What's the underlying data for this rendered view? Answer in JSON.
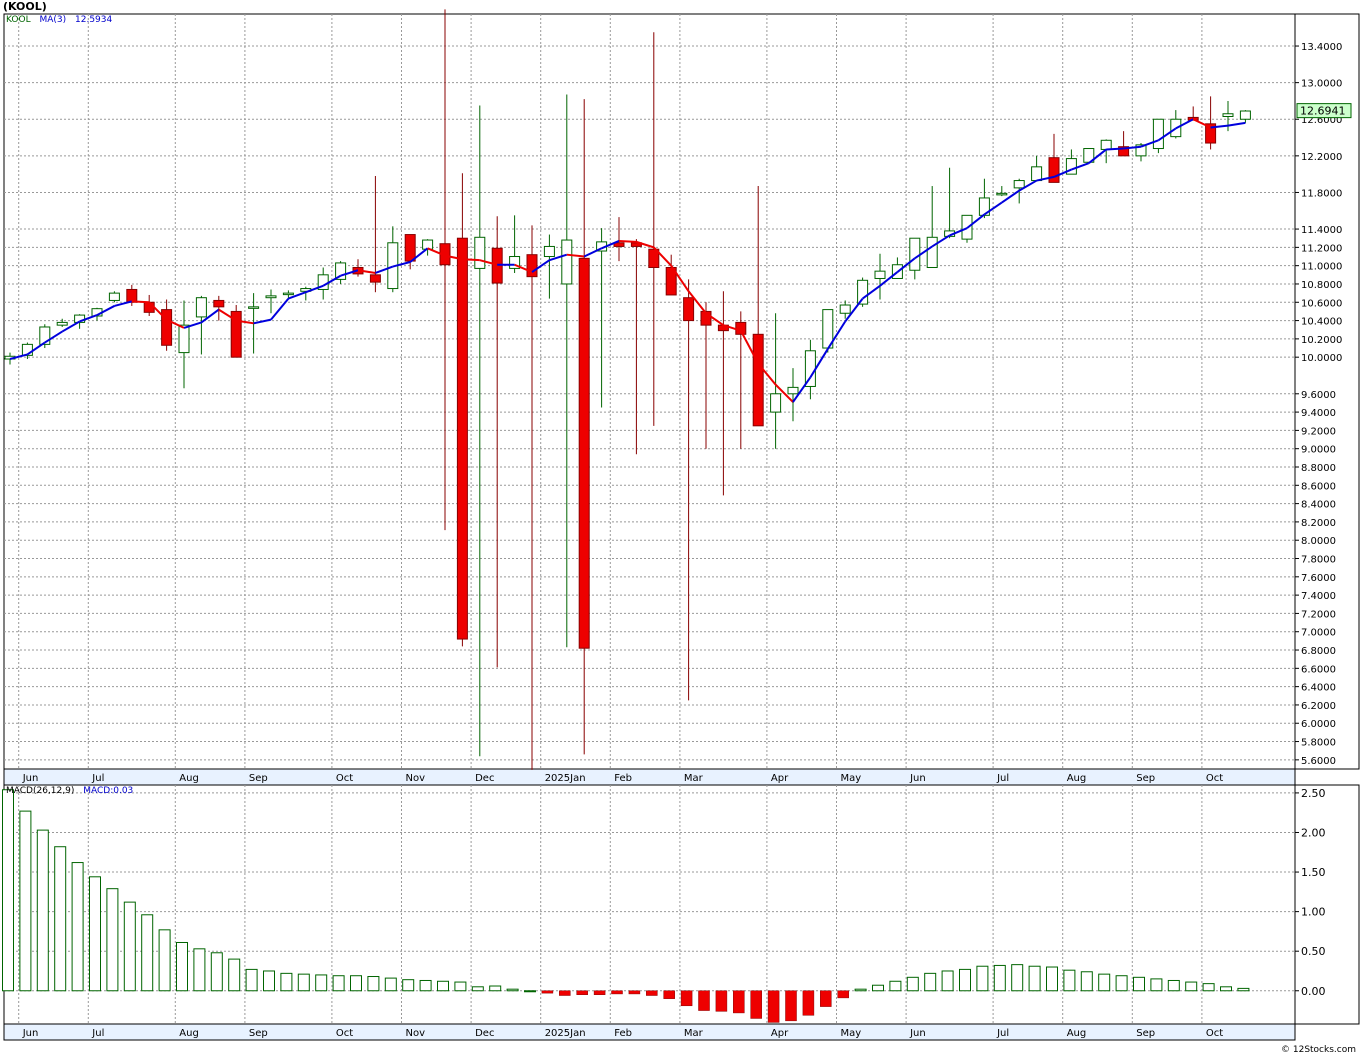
{
  "header": {
    "title": "(KOOL)"
  },
  "price_legend": {
    "symbol": "KOOL",
    "ma_label": "MA(3)",
    "ma_value": "12.5934"
  },
  "macd_legend": {
    "label": "MACD(26,12,9)",
    "value": "MACD:0.03"
  },
  "last_price": "12.6941",
  "credit": "© 12Stocks.com",
  "colors": {
    "up": "#ffffff",
    "up_stroke": "#006400",
    "down": "#ee0000",
    "down_stroke": "#880000",
    "ma_up": "#0000dd",
    "ma_down": "#ee0000",
    "price_tag": "#ccffcc"
  },
  "chart_data": [
    {
      "type": "candlestick",
      "title": "",
      "ylim": [
        5.5,
        13.75
      ],
      "y_ticks": [
        "13.4000",
        "13.0000",
        "12.6000",
        "12.2000",
        "11.8000",
        "11.4000",
        "11.2000",
        "11.0000",
        "10.8000",
        "10.6000",
        "10.4000",
        "10.2000",
        "10.0000",
        "9.6000",
        "9.4000",
        "9.2000",
        "9.0000",
        "8.8000",
        "8.6000",
        "8.4000",
        "8.2000",
        "8.0000",
        "7.8000",
        "7.6000",
        "7.4000",
        "7.2000",
        "7.0000",
        "6.8000",
        "6.6000",
        "6.4000",
        "6.2000",
        "6.0000",
        "5.8000",
        "5.6000"
      ],
      "month_labels": [
        "Jun",
        "Jul",
        "Aug",
        "Sep",
        "Oct",
        "Nov",
        "Dec",
        "2025Jan",
        "Feb",
        "Mar",
        "Apr",
        "May",
        "Jun",
        "Jul",
        "Aug",
        "Sep",
        "Oct"
      ],
      "month_start_index": [
        1,
        5,
        10,
        14,
        19,
        23,
        27,
        31,
        35,
        39,
        44,
        48,
        52,
        57,
        61,
        65,
        69
      ],
      "series": [
        {
          "name": "KOOL",
          "open": [
            9.98,
            10.02,
            10.14,
            10.35,
            10.38,
            10.45,
            10.62,
            10.74,
            10.6,
            10.52,
            10.05,
            10.44,
            10.62,
            10.5,
            10.55,
            10.65,
            10.69,
            10.72,
            10.74,
            10.85,
            10.98,
            10.9,
            10.75,
            11.34,
            11.18,
            11.24,
            11.3,
            10.97,
            11.19,
            10.97,
            11.12,
            11.1,
            10.8,
            11.08,
            11.16,
            11.25,
            11.25,
            11.18,
            10.98,
            10.65,
            10.5,
            10.35,
            10.38,
            10.25,
            9.4,
            9.6,
            9.68,
            10.1,
            10.48,
            10.58,
            10.86,
            10.86,
            10.95,
            10.98,
            11.32,
            11.29,
            11.55,
            11.78,
            11.85,
            11.93,
            12.18,
            12.0,
            12.13,
            12.27,
            12.3,
            12.2,
            12.28,
            12.41,
            12.62,
            12.55,
            12.63,
            12.6
          ],
          "high": [
            10.05,
            10.16,
            10.36,
            10.42,
            10.47,
            10.54,
            10.72,
            10.79,
            10.68,
            10.63,
            10.62,
            10.67,
            10.67,
            10.57,
            10.7,
            10.74,
            10.73,
            10.77,
            10.98,
            11.05,
            11.07,
            11.98,
            11.43,
            11.21,
            11.29,
            13.8,
            12.01,
            12.75,
            11.54,
            11.55,
            11.44,
            11.34,
            12.87,
            12.82,
            11.41,
            11.53,
            11.29,
            13.55,
            11.12,
            10.85,
            10.6,
            10.72,
            10.5,
            11.87,
            10.48,
            9.88,
            10.19,
            10.51,
            10.62,
            10.87,
            11.13,
            11.09,
            11.24,
            11.87,
            12.07,
            11.5,
            11.95,
            11.87,
            11.95,
            12.2,
            12.44,
            12.27,
            12.19,
            12.38,
            12.47,
            12.34,
            12.49,
            12.7,
            12.74,
            12.85,
            12.8,
            12.7
          ],
          "low": [
            9.92,
            9.98,
            10.1,
            10.33,
            10.31,
            10.4,
            10.6,
            10.56,
            10.45,
            10.07,
            9.66,
            10.03,
            10.4,
            10.0,
            10.04,
            10.48,
            10.64,
            10.62,
            10.63,
            10.8,
            10.88,
            10.71,
            10.71,
            10.96,
            11.11,
            8.11,
            6.84,
            5.64,
            6.61,
            10.92,
            5.49,
            10.64,
            6.83,
            5.66,
            9.45,
            11.05,
            8.94,
            9.25,
            10.77,
            6.25,
            9.0,
            8.49,
            9.0,
            9.25,
            9.0,
            9.3,
            9.54,
            10.05,
            10.42,
            10.55,
            10.63,
            10.86,
            10.85,
            10.98,
            11.3,
            11.25,
            11.52,
            11.76,
            11.68,
            11.93,
            12.15,
            12.03,
            12.14,
            12.12,
            12.29,
            12.14,
            12.23,
            12.39,
            12.6,
            12.27,
            12.47,
            12.56
          ],
          "close": [
            10.01,
            10.14,
            10.33,
            10.38,
            10.46,
            10.53,
            10.7,
            10.6,
            10.49,
            10.13,
            10.35,
            10.65,
            10.55,
            10.0,
            10.55,
            10.67,
            10.7,
            10.75,
            10.9,
            11.03,
            10.91,
            10.82,
            11.25,
            11.05,
            11.28,
            11.01,
            6.92,
            11.31,
            10.81,
            11.1,
            10.88,
            11.21,
            11.28,
            6.82,
            11.26,
            11.21,
            11.21,
            10.98,
            10.68,
            10.4,
            10.35,
            10.29,
            10.25,
            9.25,
            9.6,
            9.67,
            10.07,
            10.52,
            10.57,
            10.84,
            10.94,
            11.01,
            11.3,
            11.31,
            11.38,
            11.55,
            11.74,
            11.79,
            11.93,
            12.08,
            11.91,
            12.17,
            12.28,
            12.37,
            12.2,
            12.32,
            12.6,
            12.6,
            12.59,
            12.34,
            12.66,
            12.69
          ]
        },
        {
          "name": "MA(3)",
          "values": [
            9.98,
            10.03,
            10.16,
            10.28,
            10.39,
            10.46,
            10.56,
            10.61,
            10.6,
            10.41,
            10.32,
            10.38,
            10.52,
            10.4,
            10.37,
            10.41,
            10.64,
            10.71,
            10.78,
            10.89,
            10.95,
            10.92,
            10.99,
            11.04,
            11.19,
            11.11,
            11.07,
            11.06,
            11.01,
            11.01,
            10.93,
            11.06,
            11.12,
            11.1,
            11.19,
            11.27,
            11.26,
            11.2,
            11.0,
            10.72,
            10.48,
            10.35,
            10.29,
            9.93,
            9.7,
            9.51,
            9.78,
            10.09,
            10.39,
            10.64,
            10.78,
            10.93,
            11.08,
            11.21,
            11.33,
            11.41,
            11.56,
            11.69,
            11.82,
            11.93,
            11.97,
            12.05,
            12.12,
            12.27,
            12.28,
            12.3,
            12.37,
            12.5,
            12.6,
            12.51,
            12.53,
            12.56
          ]
        }
      ]
    },
    {
      "type": "bar",
      "title": "",
      "ylim": [
        -0.42,
        2.6
      ],
      "y_ticks": [
        "2.50",
        "2.00",
        "1.50",
        "1.00",
        "0.50",
        "0.00"
      ],
      "month_labels": [
        "Jun",
        "Jul",
        "Aug",
        "Sep",
        "Oct",
        "Nov",
        "Dec",
        "2025Jan",
        "Feb",
        "Mar",
        "Apr",
        "May",
        "Jun",
        "Jul",
        "Aug",
        "Sep",
        "Oct"
      ],
      "series": [
        {
          "name": "MACD",
          "values": [
            2.54,
            2.27,
            2.03,
            1.82,
            1.62,
            1.44,
            1.29,
            1.12,
            0.96,
            0.77,
            0.61,
            0.53,
            0.48,
            0.4,
            0.27,
            0.25,
            0.22,
            0.21,
            0.2,
            0.19,
            0.19,
            0.18,
            0.16,
            0.14,
            0.13,
            0.12,
            0.11,
            0.05,
            0.06,
            0.02,
            0.0,
            -0.03,
            -0.06,
            -0.05,
            -0.05,
            -0.04,
            -0.04,
            -0.06,
            -0.1,
            -0.19,
            -0.25,
            -0.26,
            -0.28,
            -0.35,
            -0.4,
            -0.38,
            -0.31,
            -0.2,
            -0.09,
            0.02,
            0.07,
            0.12,
            0.17,
            0.22,
            0.25,
            0.27,
            0.31,
            0.32,
            0.33,
            0.31,
            0.3,
            0.26,
            0.24,
            0.21,
            0.19,
            0.17,
            0.15,
            0.13,
            0.11,
            0.09,
            0.05,
            0.03
          ]
        }
      ]
    }
  ]
}
